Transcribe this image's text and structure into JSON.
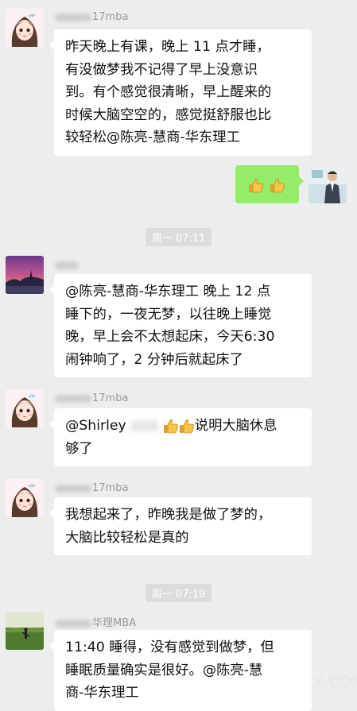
{
  "messages": [
    {
      "sender_suffix": "17mba",
      "lines": [
        "昨天晚上有课，晚上 11 点才睡，",
        "有没做梦我不记得了早上没意识",
        "到。有个感觉很清晰，早上醒来的",
        "时候大脑空空的，感觉挺舒服也比",
        "较轻松@陈亮-慧商-华东理工"
      ]
    },
    {
      "sender_suffix": "",
      "lines": [
        "@陈亮-慧商-华东理工  晚上 12 点",
        "睡下的，一夜无梦，以往晚上睡觉",
        "晚，早上会不太想起床，今天6:30",
        "闹钟响了，2 分钟后就起床了"
      ]
    },
    {
      "sender_suffix": "17mba",
      "line1_prefix": "@Shirley",
      "line1_suffix": "说明大脑休息",
      "line2": "够了"
    },
    {
      "sender_suffix": "17mba",
      "lines": [
        "我想起来了，昨晚我是做了梦的，",
        "大脑比较轻松是真的"
      ]
    },
    {
      "sender_suffix": "华理MBA",
      "lines": [
        "11:40 睡得，没有感觉到做梦，但",
        "睡眠质量确实是很好。@陈亮-慧",
        "商-华东理工"
      ]
    }
  ],
  "timestamps": [
    "周一 07:11",
    "周一 07:19"
  ],
  "watermark": "X.COM",
  "icons": [
    "thumbs-up-emoji",
    "avatar-girl",
    "avatar-sunset",
    "avatar-man",
    "avatar-field"
  ],
  "colors": {
    "background": "#ededed",
    "bubble": "#ffffff",
    "self_bubble": "#95ec69"
  }
}
